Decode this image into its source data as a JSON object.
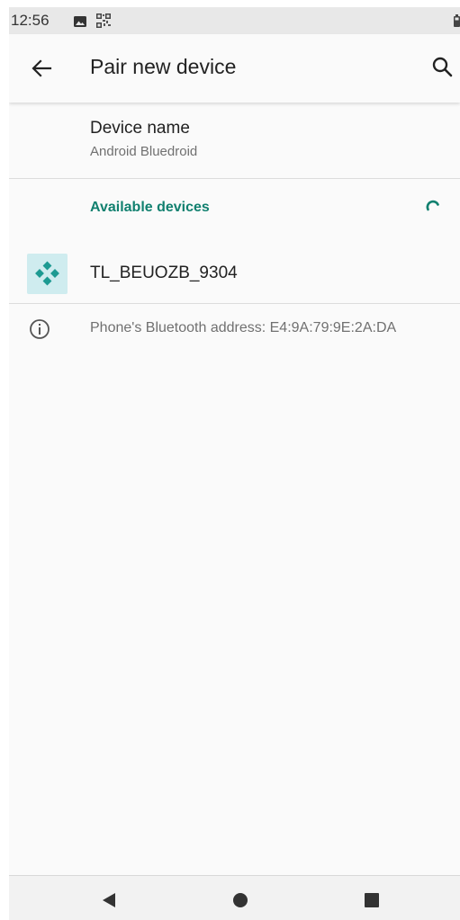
{
  "status_bar": {
    "time": "12:56",
    "icons": [
      "image-icon",
      "qr-code-icon",
      "battery-icon"
    ]
  },
  "app_bar": {
    "title": "Pair new device",
    "back_icon": "arrow-left-icon",
    "search_icon": "search-icon"
  },
  "device_name": {
    "title": "Device name",
    "value": "Android Bluedroid"
  },
  "available_devices": {
    "title": "Available devices",
    "spinner_icon": "progress-spinner-icon",
    "items": [
      {
        "name": "TL_BEUOZB_9304",
        "icon": "gamepad-icon"
      }
    ]
  },
  "info": {
    "icon": "info-icon",
    "text": "Phone's Bluetooth address: E4:9A:79:9E:2A:DA"
  },
  "nav_bar": {
    "buttons": [
      "back-triangle-icon",
      "home-circle-icon",
      "recents-square-icon"
    ]
  },
  "colors": {
    "accent": "#11806f",
    "device_icon_bg": "#cfecef",
    "background": "#fafafa"
  }
}
